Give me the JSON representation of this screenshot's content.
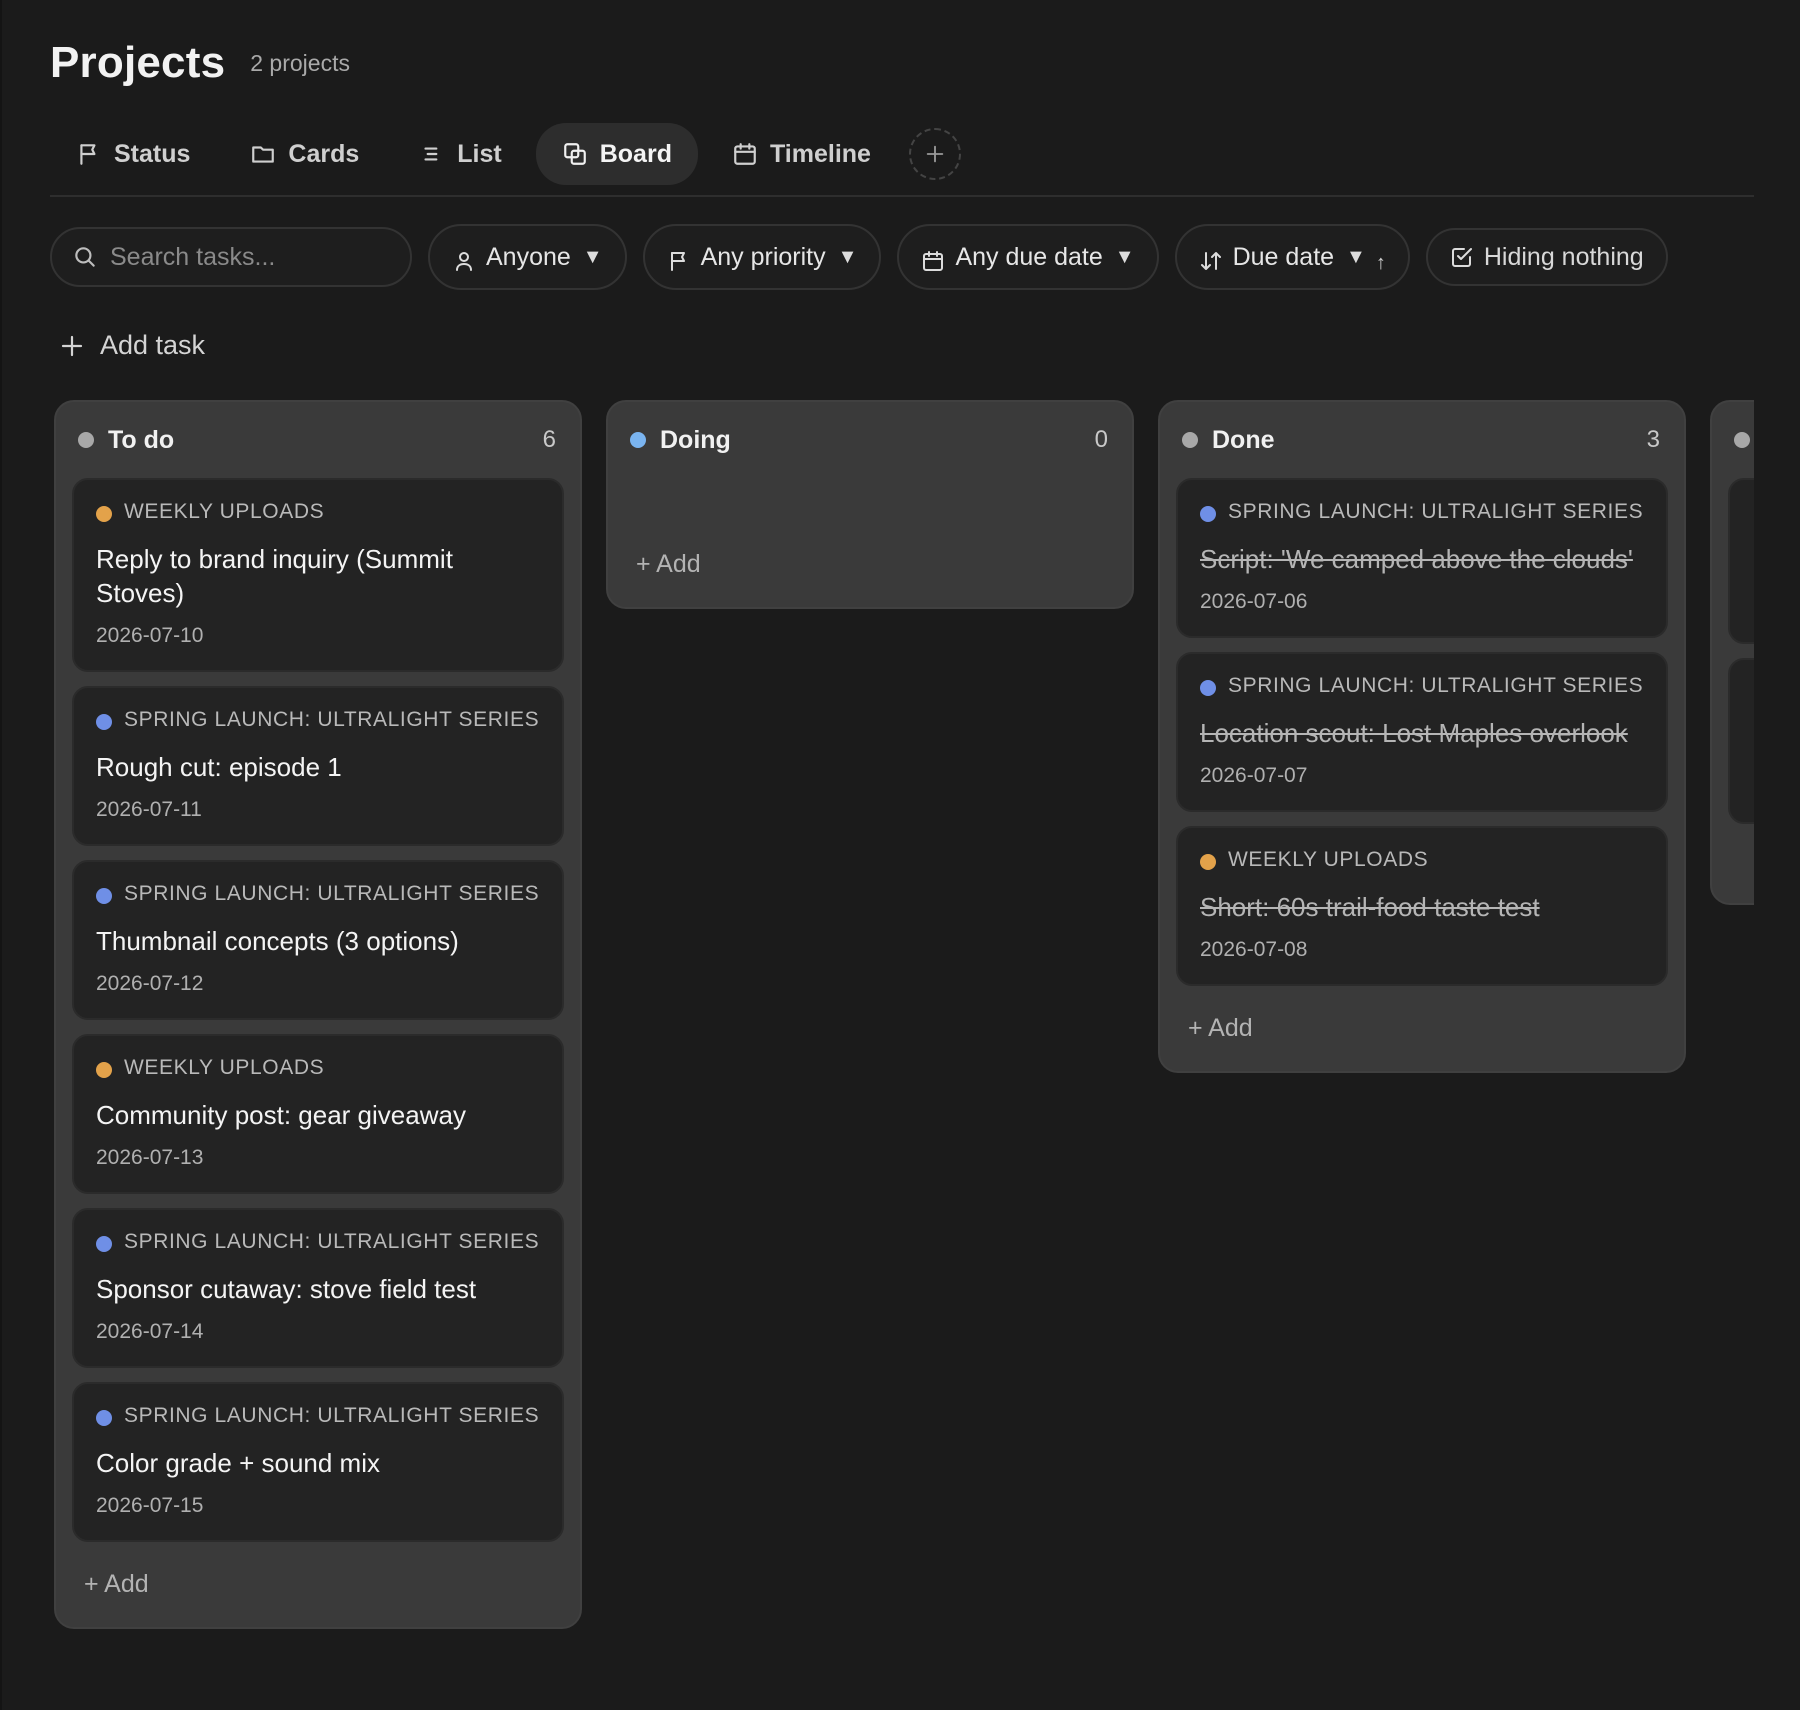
{
  "header": {
    "title": "Projects",
    "project_count": "2 projects"
  },
  "tabs": [
    {
      "label": "Status",
      "icon": "flag-icon",
      "active": false
    },
    {
      "label": "Cards",
      "icon": "folder-icon",
      "active": false
    },
    {
      "label": "List",
      "icon": "list-icon",
      "active": false
    },
    {
      "label": "Board",
      "icon": "board-icon",
      "active": true
    },
    {
      "label": "Timeline",
      "icon": "calendar-icon",
      "active": false
    }
  ],
  "filters": {
    "search_placeholder": "Search tasks...",
    "assignee": "Anyone",
    "priority": "Any priority",
    "due": "Any due date",
    "sort": "Due date",
    "sort_direction": "↑",
    "hiding": "Hiding nothing"
  },
  "add_task_label": "Add task",
  "colors": {
    "weekly": "#e3a24a",
    "spring": "#6f8fe6",
    "todo_dot": "#a8a8a8",
    "doing_dot": "#7ab4f0",
    "done_dot": "#a8a8a8"
  },
  "columns": [
    {
      "title": "To do",
      "count": "6",
      "add_label": "+ Add",
      "cards": [
        {
          "project": "WEEKLY UPLOADS",
          "title": "Reply to brand inquiry (Summit Stoves)",
          "date": "2026-07-10"
        },
        {
          "project": "SPRING LAUNCH: ULTRALIGHT SERIES",
          "title": "Rough cut: episode 1",
          "date": "2026-07-11"
        },
        {
          "project": "SPRING LAUNCH: ULTRALIGHT SERIES",
          "title": "Thumbnail concepts (3 options)",
          "date": "2026-07-12"
        },
        {
          "project": "WEEKLY UPLOADS",
          "title": "Community post: gear giveaway",
          "date": "2026-07-13"
        },
        {
          "project": "SPRING LAUNCH: ULTRALIGHT SERIES",
          "title": "Sponsor cutaway: stove field test",
          "date": "2026-07-14"
        },
        {
          "project": "SPRING LAUNCH: ULTRALIGHT SERIES",
          "title": "Color grade + sound mix",
          "date": "2026-07-15"
        }
      ]
    },
    {
      "title": "Doing",
      "count": "0",
      "add_label": "+ Add",
      "cards": []
    },
    {
      "title": "Done",
      "count": "3",
      "add_label": "+ Add",
      "cards": [
        {
          "project": "SPRING LAUNCH: ULTRALIGHT SERIES",
          "title": "Script: 'We camped above the clouds'",
          "date": "2026-07-06"
        },
        {
          "project": "SPRING LAUNCH: ULTRALIGHT SERIES",
          "title": "Location scout: Lost Maples overlook",
          "date": "2026-07-07"
        },
        {
          "project": "WEEKLY UPLOADS",
          "title": "Short: 60s trail-food taste test",
          "date": "2026-07-08"
        }
      ]
    }
  ]
}
